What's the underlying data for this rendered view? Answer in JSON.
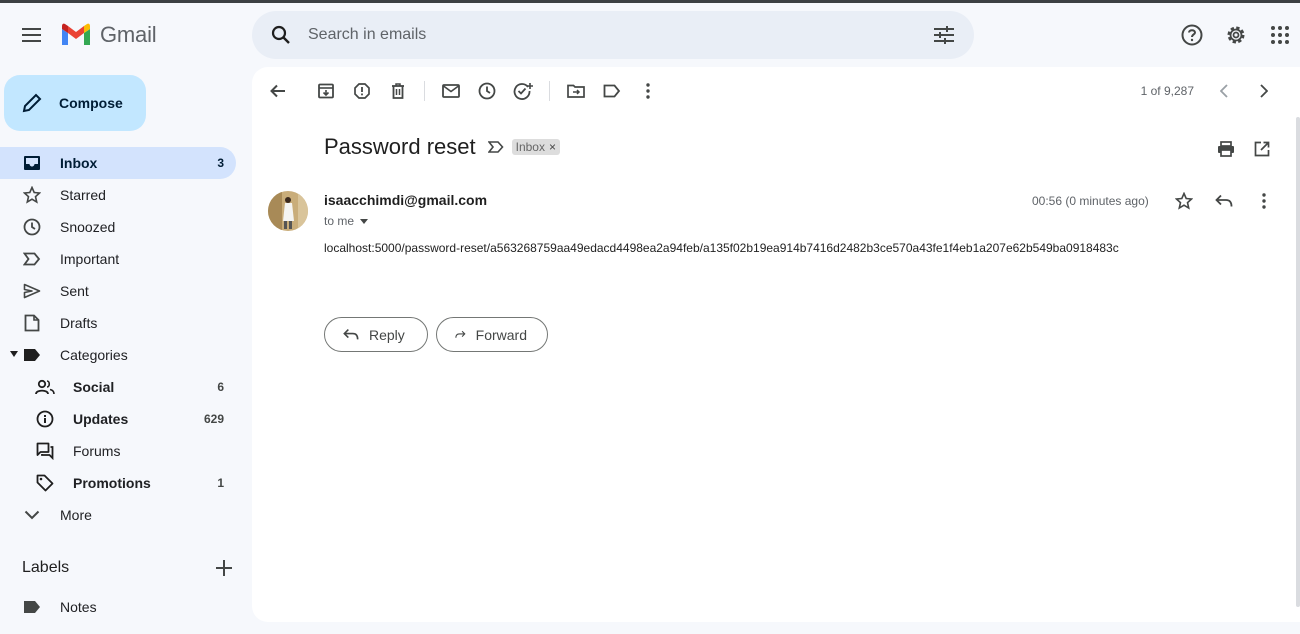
{
  "app": {
    "name": "Gmail"
  },
  "search": {
    "placeholder": "Search in emails"
  },
  "compose": {
    "label": "Compose"
  },
  "nav": {
    "items": [
      {
        "label": "Inbox",
        "count": "3",
        "icon": "inbox-icon"
      },
      {
        "label": "Starred",
        "count": "",
        "icon": "star-icon"
      },
      {
        "label": "Snoozed",
        "count": "",
        "icon": "clock-icon"
      },
      {
        "label": "Important",
        "count": "",
        "icon": "important-icon"
      },
      {
        "label": "Sent",
        "count": "",
        "icon": "send-icon"
      },
      {
        "label": "Drafts",
        "count": "",
        "icon": "draft-icon"
      },
      {
        "label": "Categories",
        "count": "",
        "icon": "label-icon"
      }
    ],
    "categories": [
      {
        "label": "Social",
        "count": "6",
        "icon": "people-icon"
      },
      {
        "label": "Updates",
        "count": "629",
        "icon": "info-icon"
      },
      {
        "label": "Forums",
        "count": "",
        "icon": "forum-icon"
      },
      {
        "label": "Promotions",
        "count": "1",
        "icon": "tag-icon"
      }
    ],
    "more_label": "More"
  },
  "labels": {
    "heading": "Labels",
    "items": [
      {
        "label": "Notes"
      }
    ]
  },
  "pager": {
    "text": "1 of 9,287"
  },
  "email": {
    "subject": "Password reset",
    "chip": "Inbox",
    "sender": "isaacchimdi@gmail.com",
    "to": "to me",
    "time": "00:56 (0 minutes ago)",
    "body": "localhost:5000/password-reset/a563268759aa49edacd4498ea2a94feb/a135f02b19ea914b7416d2482b3ce570a43fe1f4eb1a207e62b549ba0918483c"
  },
  "actions": {
    "reply": "Reply",
    "forward": "Forward"
  },
  "colors": {
    "compose_bg": "#c2e7ff",
    "active_nav": "#d3e3fd",
    "background": "#f6f8fc"
  }
}
